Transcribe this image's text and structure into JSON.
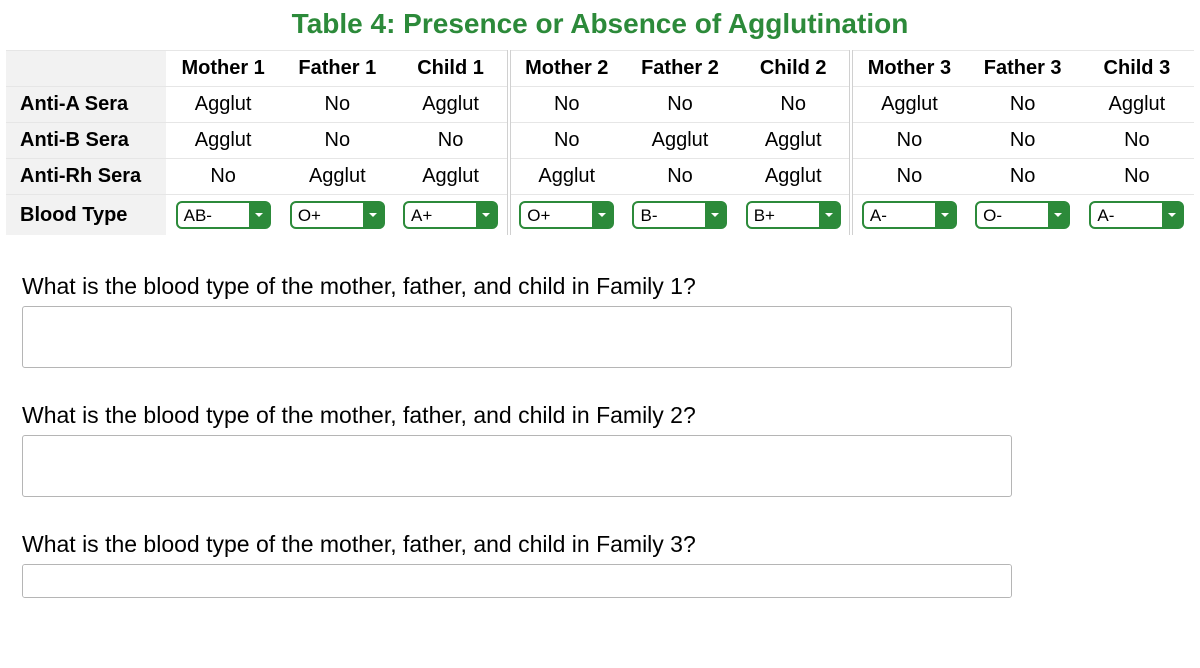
{
  "title": "Table 4: Presence or Absence of Agglutination",
  "columns": [
    "Mother 1",
    "Father 1",
    "Child 1",
    "Mother 2",
    "Father 2",
    "Child 2",
    "Mother 3",
    "Father 3",
    "Child 3"
  ],
  "rows": [
    {
      "label": "Anti-A Sera",
      "cells": [
        "Agglut",
        "No",
        "Agglut",
        "No",
        "No",
        "No",
        "Agglut",
        "No",
        "Agglut"
      ]
    },
    {
      "label": "Anti-B Sera",
      "cells": [
        "Agglut",
        "No",
        "No",
        "No",
        "Agglut",
        "Agglut",
        "No",
        "No",
        "No"
      ]
    },
    {
      "label": "Anti-Rh Sera",
      "cells": [
        "No",
        "Agglut",
        "Agglut",
        "Agglut",
        "No",
        "Agglut",
        "No",
        "No",
        "No"
      ]
    }
  ],
  "bloodTypeRow": {
    "label": "Blood Type",
    "values": [
      "AB-",
      "O+",
      "A+",
      "O+",
      "B-",
      "B+",
      "A-",
      "O-",
      "A-"
    ]
  },
  "questions": [
    "What is the blood type of the mother, father, and child in Family 1?",
    "What is the blood type of the mother, father, and child in Family 2?",
    "What is the blood type of the mother, father, and child in Family 3?"
  ],
  "colors": {
    "accent": "#2c8a3a"
  }
}
